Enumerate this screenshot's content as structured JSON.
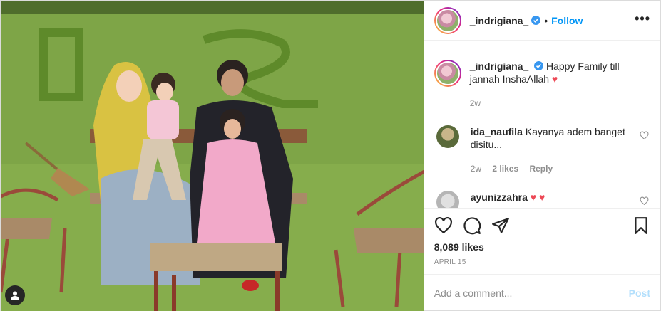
{
  "header": {
    "username": "_indrigiana_",
    "separator": "•",
    "follow_label": "Follow",
    "more_label": "•••"
  },
  "caption": {
    "username": "_indrigiana_",
    "text": "Happy Family till jannah InshaAllah",
    "emoji": "♥",
    "time": "2w"
  },
  "comments": [
    {
      "username": "ida_naufila",
      "text": "Kayanya adem banget disitu...",
      "time": "2w",
      "likes": "2 likes",
      "reply": "Reply"
    },
    {
      "username": "ayunizzahra",
      "text": "",
      "emoji": "♥ ♥"
    }
  ],
  "actions": {
    "likes": "8,089 likes",
    "date": "APRIL 15"
  },
  "add_comment": {
    "placeholder": "Add a comment...",
    "post_label": "Post"
  },
  "colors": {
    "link_blue": "#0095f6",
    "post_disabled": "#b2dffc",
    "meta_gray": "#8e8e8e",
    "heart_red": "#ed4956"
  },
  "icons": {
    "like": "heart-icon",
    "comment": "comment-icon",
    "share": "paper-plane-icon",
    "save": "bookmark-icon",
    "tags": "user-tag-icon"
  }
}
